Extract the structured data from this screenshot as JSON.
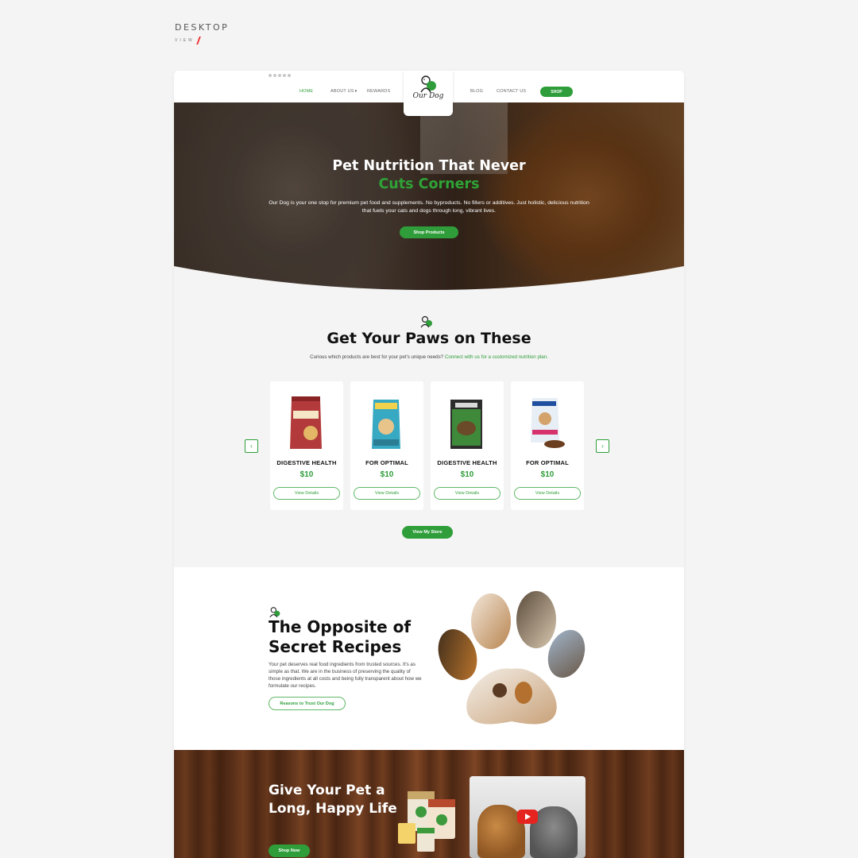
{
  "mockup": {
    "label": "DESKTOP",
    "sublabel": "VIEW"
  },
  "nav": {
    "home": "HOME",
    "about": "ABOUT US",
    "rewards": "REWARDS",
    "blog": "BLOG",
    "contact": "CONTACT US",
    "shop": "SHOP",
    "logo_text": "Our Dog",
    "accent_color": "#2f9e3a"
  },
  "hero": {
    "title_line1": "Pet Nutrition That Never",
    "title_line2": "Cuts Corners",
    "description": "Our Dog is your one stop for premium pet food and supplements. No byproducts. No fillers or additives. Just holistic, delicious nutrition that fuels your cats and dogs through long, vibrant lives.",
    "button": "Shop Products"
  },
  "products": {
    "title": "Get Your Paws on These",
    "subtitle": "Curious which products are best for your pet's unique needs?",
    "subtitle_link": "Connect with us for a customized nutrition plan.",
    "items": [
      {
        "title": "DIGESTIVE HEALTH",
        "price": "$10",
        "button": "View Details",
        "color": "#b23a3a"
      },
      {
        "title": "FOR OPTIMAL",
        "price": "$10",
        "button": "View Details",
        "color": "#38a9c2"
      },
      {
        "title": "DIGESTIVE HEALTH",
        "price": "$10",
        "button": "View Details",
        "color": "#2f6e2f"
      },
      {
        "title": "FOR OPTIMAL",
        "price": "$10",
        "button": "View Details",
        "color": "#e8eef5"
      }
    ],
    "store_button": "View My Store"
  },
  "recipes": {
    "title": "The Opposite of Secret Recipes",
    "description": "Your pet deserves real food ingredients from trusted sources. It's as simple as that. We are in the business of preserving the quality of those ingredients at all costs and being fully transparent about how we formulate our recipes.",
    "button": "Reasons to Trust Our Dog"
  },
  "promo": {
    "title": "Give Your Pet a Long, Happy Life",
    "button": "Shop Now"
  }
}
